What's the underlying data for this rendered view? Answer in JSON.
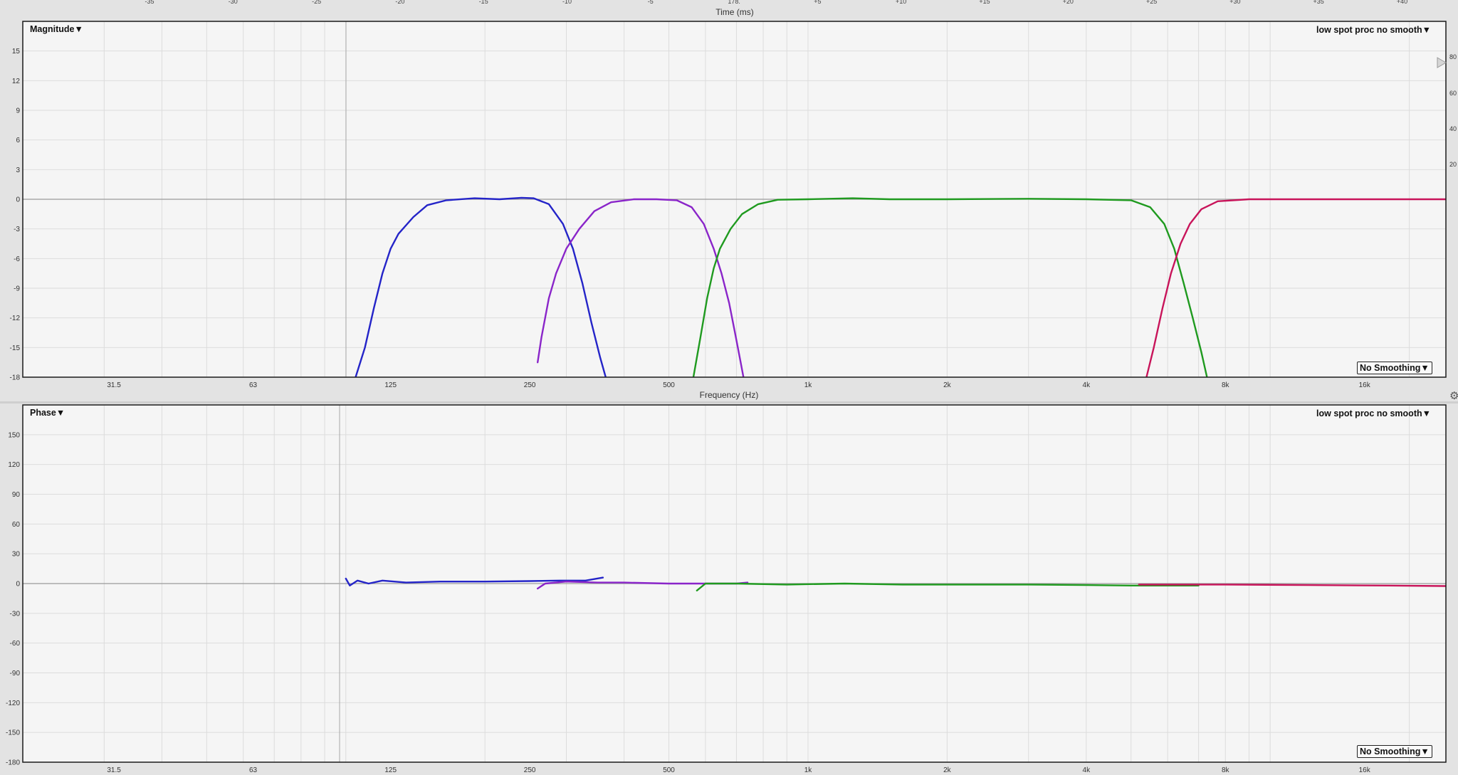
{
  "time_axis": {
    "label": "Time (ms)",
    "ticks": [
      "-35",
      "-30",
      "-25",
      "-20",
      "-15",
      "-10",
      "-5",
      "178.",
      "+5",
      "+10",
      "+15",
      "+20",
      "+25",
      "+30",
      "+35",
      "+40"
    ]
  },
  "magnitude_panel": {
    "title": "Magnitude▼",
    "preset": "low spot proc no smooth▼",
    "smoothing": "No Smoothing▼",
    "right_axis_ticks": [
      "80",
      "60",
      "40",
      "20"
    ]
  },
  "phase_panel": {
    "title": "Phase▼",
    "preset": "low spot proc no smooth▼",
    "smoothing": "No Smoothing▼"
  },
  "frequency_axis_label": "Frequency (Hz)",
  "icons": {
    "gear": "gear-icon",
    "marker": "play-triangle-icon"
  },
  "colors": {
    "blue": "#2424c8",
    "purple": "#8a25c9",
    "green": "#1f9a1f",
    "crimson": "#c8145a",
    "plot_bg": "#f5f5f5",
    "grid": "#dcdcdc",
    "zero_line": "#9a9a9a"
  },
  "chart_data": [
    {
      "type": "line",
      "name": "Magnitude",
      "xscale": "log",
      "xlim": [
        20,
        24000
      ],
      "ylim": [
        -18,
        18
      ],
      "x_ticks": [
        {
          "v": 31.5,
          "l": "31.5"
        },
        {
          "v": 63,
          "l": "63"
        },
        {
          "v": 125,
          "l": "125"
        },
        {
          "v": 250,
          "l": "250"
        },
        {
          "v": 500,
          "l": "500"
        },
        {
          "v": 1000,
          "l": "1k"
        },
        {
          "v": 2000,
          "l": "2k"
        },
        {
          "v": 4000,
          "l": "4k"
        },
        {
          "v": 8000,
          "l": "8k"
        },
        {
          "v": 16000,
          "l": "16k"
        }
      ],
      "y_ticks": [
        15,
        12,
        9,
        6,
        3,
        0,
        -3,
        -6,
        -9,
        -12,
        -15,
        -18
      ],
      "grid": true,
      "series": [
        {
          "color": "blue",
          "points": [
            [
              105,
              -18
            ],
            [
              110,
              -15
            ],
            [
              115,
              -11
            ],
            [
              120,
              -7.5
            ],
            [
              125,
              -5
            ],
            [
              130,
              -3.5
            ],
            [
              140,
              -1.8
            ],
            [
              150,
              -0.6
            ],
            [
              165,
              -0.1
            ],
            [
              190,
              0.1
            ],
            [
              215,
              0
            ],
            [
              240,
              0.15
            ],
            [
              255,
              0.1
            ],
            [
              275,
              -0.5
            ],
            [
              295,
              -2.5
            ],
            [
              310,
              -5
            ],
            [
              325,
              -8.5
            ],
            [
              340,
              -12.5
            ],
            [
              355,
              -16
            ],
            [
              365,
              -18
            ]
          ]
        },
        {
          "color": "purple",
          "points": [
            [
              260,
              -16.5
            ],
            [
              265,
              -14
            ],
            [
              275,
              -10
            ],
            [
              285,
              -7.5
            ],
            [
              300,
              -5
            ],
            [
              320,
              -3
            ],
            [
              345,
              -1.2
            ],
            [
              375,
              -0.3
            ],
            [
              420,
              0
            ],
            [
              470,
              0
            ],
            [
              520,
              -0.1
            ],
            [
              560,
              -0.8
            ],
            [
              595,
              -2.5
            ],
            [
              625,
              -5
            ],
            [
              650,
              -7.5
            ],
            [
              675,
              -10.5
            ],
            [
              695,
              -13.5
            ],
            [
              715,
              -16.5
            ],
            [
              725,
              -18
            ]
          ]
        },
        {
          "color": "green",
          "points": [
            [
              565,
              -18
            ],
            [
              585,
              -14
            ],
            [
              605,
              -10
            ],
            [
              625,
              -7
            ],
            [
              645,
              -5
            ],
            [
              680,
              -3
            ],
            [
              720,
              -1.5
            ],
            [
              780,
              -0.5
            ],
            [
              860,
              -0.05
            ],
            [
              1000,
              0
            ],
            [
              1250,
              0.1
            ],
            [
              1500,
              0
            ],
            [
              2000,
              0
            ],
            [
              3000,
              0.05
            ],
            [
              4000,
              0
            ],
            [
              5000,
              -0.1
            ],
            [
              5500,
              -0.8
            ],
            [
              5900,
              -2.5
            ],
            [
              6200,
              -5
            ],
            [
              6500,
              -8.5
            ],
            [
              6800,
              -12
            ],
            [
              7100,
              -15.5
            ],
            [
              7300,
              -18
            ]
          ]
        },
        {
          "color": "crimson",
          "points": [
            [
              5400,
              -18
            ],
            [
              5600,
              -15
            ],
            [
              5850,
              -11
            ],
            [
              6100,
              -7.5
            ],
            [
              6400,
              -4.5
            ],
            [
              6700,
              -2.5
            ],
            [
              7100,
              -1
            ],
            [
              7700,
              -0.2
            ],
            [
              9000,
              0
            ],
            [
              16000,
              0
            ],
            [
              24000,
              0
            ]
          ]
        }
      ]
    },
    {
      "type": "line",
      "name": "Phase",
      "xscale": "log",
      "xlim": [
        20,
        24000
      ],
      "ylim": [
        -180,
        180
      ],
      "x_ticks": [
        {
          "v": 31.5,
          "l": "31.5"
        },
        {
          "v": 63,
          "l": "63"
        },
        {
          "v": 125,
          "l": "125"
        },
        {
          "v": 250,
          "l": "250"
        },
        {
          "v": 500,
          "l": "500"
        },
        {
          "v": 1000,
          "l": "1k"
        },
        {
          "v": 2000,
          "l": "2k"
        },
        {
          "v": 4000,
          "l": "4k"
        },
        {
          "v": 8000,
          "l": "8k"
        },
        {
          "v": 16000,
          "l": "16k"
        }
      ],
      "y_ticks": [
        150,
        120,
        90,
        60,
        30,
        0,
        -30,
        -60,
        -90,
        -120,
        -150,
        -180
      ],
      "grid": true,
      "series": [
        {
          "color": "blue",
          "points": [
            [
              100,
              5
            ],
            [
              102,
              -2
            ],
            [
              106,
              3
            ],
            [
              112,
              0
            ],
            [
              120,
              3
            ],
            [
              135,
              1
            ],
            [
              160,
              2
            ],
            [
              200,
              2
            ],
            [
              250,
              2.5
            ],
            [
              290,
              3
            ],
            [
              330,
              3
            ],
            [
              360,
              6
            ]
          ]
        },
        {
          "color": "purple",
          "points": [
            [
              260,
              -5
            ],
            [
              270,
              0
            ],
            [
              300,
              2
            ],
            [
              350,
              1
            ],
            [
              400,
              1
            ],
            [
              500,
              0
            ],
            [
              600,
              0
            ],
            [
              700,
              0
            ],
            [
              740,
              1
            ]
          ]
        },
        {
          "color": "green",
          "points": [
            [
              575,
              -7
            ],
            [
              600,
              0
            ],
            [
              700,
              0
            ],
            [
              900,
              -1
            ],
            [
              1200,
              0
            ],
            [
              1600,
              -1
            ],
            [
              2200,
              -1
            ],
            [
              3000,
              -1
            ],
            [
              4000,
              -1.5
            ],
            [
              5000,
              -2
            ],
            [
              7000,
              -2
            ]
          ]
        },
        {
          "color": "crimson",
          "points": [
            [
              5200,
              -1
            ],
            [
              8000,
              -1
            ],
            [
              12000,
              -1.5
            ],
            [
              18000,
              -2
            ],
            [
              24000,
              -2.5
            ]
          ]
        }
      ]
    }
  ]
}
